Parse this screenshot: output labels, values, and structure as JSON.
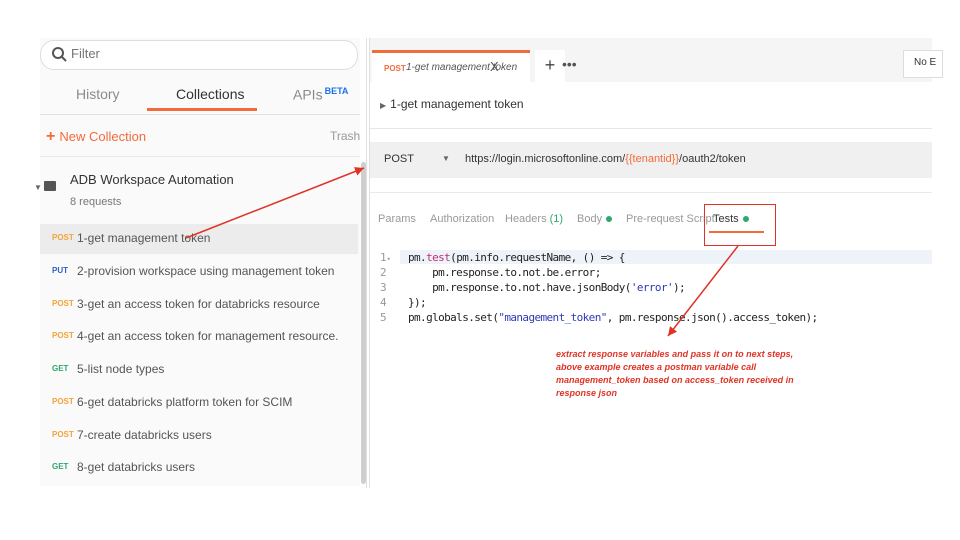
{
  "sidebar": {
    "filter_placeholder": "Filter",
    "tabs": [
      {
        "label": "History"
      },
      {
        "label": "Collections"
      },
      {
        "label": "APIs",
        "badge": "BETA"
      }
    ],
    "new_collection_label": "New Collection",
    "trash_label": "Trash",
    "collection": {
      "name": "ADB Workspace Automation",
      "count": "8 requests"
    },
    "requests": [
      {
        "method": "POST",
        "name": "1-get management token"
      },
      {
        "method": "PUT",
        "name": "2-provision workspace using management token"
      },
      {
        "method": "POST",
        "name": "3-get an access token for databricks resource"
      },
      {
        "method": "POST",
        "name": "4-get an access token for management resource."
      },
      {
        "method": "GET",
        "name": "5-list node types"
      },
      {
        "method": "POST",
        "name": "6-get databricks platform token for SCIM"
      },
      {
        "method": "POST",
        "name": "7-create databricks users"
      },
      {
        "method": "GET",
        "name": "8-get databricks users"
      }
    ]
  },
  "main": {
    "tab": {
      "method": "POST",
      "title": "1-get management token",
      "close": "X"
    },
    "add_tab": "+",
    "more_tabs": "•••",
    "environment": "No E",
    "breadcrumb": "1-get management token",
    "method": "POST",
    "url": {
      "prefix": "https://login.microsoftonline.com/",
      "variable": "{{tenantid}}",
      "suffix": "/oauth2/token"
    },
    "request_tabs": {
      "params": "Params",
      "authorization": "Authorization",
      "headers": "Headers",
      "headers_count": "(1)",
      "body": "Body",
      "prerequest": "Pre-request Script",
      "tests": "Tests"
    },
    "code": {
      "line_numbers": [
        "1",
        "2",
        "3",
        "4",
        "5"
      ],
      "l1_a": "pm.",
      "l1_kw": "test",
      "l1_b": "(pm.info.requestName, () => {",
      "l2": "    pm.response.to.not.be.error;",
      "l3_a": "    pm.response.to.not.have.jsonBody(",
      "l3_str": "'error'",
      "l3_b": ");",
      "l4": "});",
      "l5_a": "pm.globals.set(",
      "l5_str": "\"management_token\"",
      "l5_b": ", pm.response.json().access_token);"
    },
    "annotation": [
      "extract response variables and pass it on to next steps,",
      "above example creates a postman variable call",
      "management_token based on access_token received in",
      "response json"
    ]
  },
  "colors": {
    "accent": "#f26b3a",
    "annotation_red": "#e03326",
    "post": "#f2a33a",
    "put": "#2a62c9",
    "get": "#2ea86b"
  }
}
